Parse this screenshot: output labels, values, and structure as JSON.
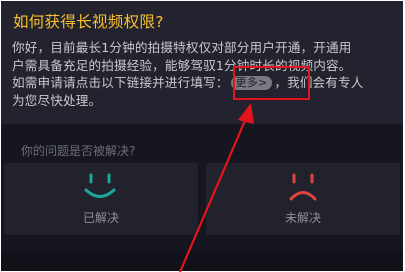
{
  "faq": {
    "title": "如何获得长视频权限?",
    "body_lines": [
      "你好，目前最长1分钟的拍摄特权仅对部分用户开通，开通用",
      "户需具备充足的拍摄经验，能够驾驭1分钟时长的视频内容。"
    ],
    "line3_before": "如需申请请点击以下链接并进行填写：",
    "more_label": "更多>",
    "line3_after": "，我们会有专人",
    "line4": "为您尽快处理。"
  },
  "feedback": {
    "question": "你的问题是否被解决?",
    "resolved_label": "已解决",
    "unresolved_label": "未解决"
  },
  "colors": {
    "accent_title": "#f6c02c",
    "resolved_face": "#1ea69a",
    "unresolved_face": "#e0443f",
    "annotation": "#e3141b"
  },
  "icons": {
    "resolved": "smile-face-icon",
    "unresolved": "frown-face-icon"
  }
}
